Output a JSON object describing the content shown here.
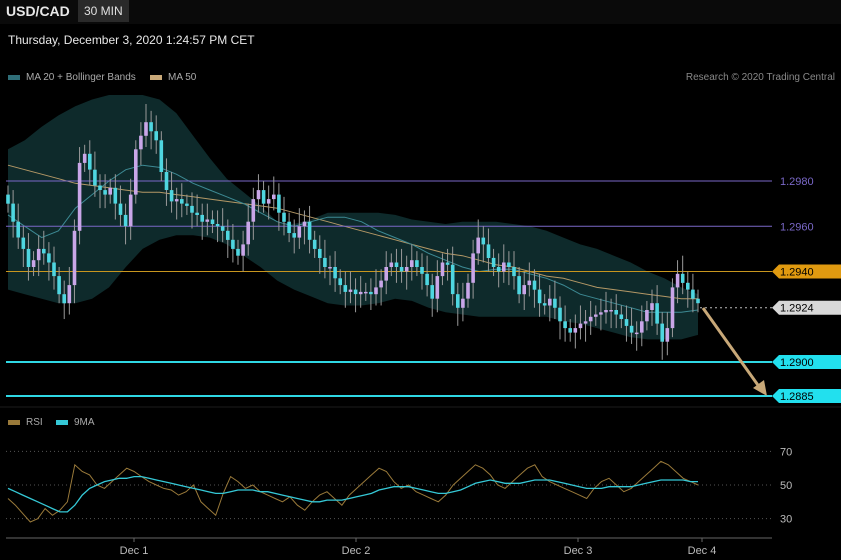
{
  "header": {
    "symbol": "USD/CAD",
    "timeframe": "30 MIN",
    "datetime": "Thursday, December 3, 2020 1:24:57 PM CET"
  },
  "legend": {
    "ma20_label": "MA 20 + Bollinger Bands",
    "ma50_label": "MA 50",
    "credit": "Research © 2020 Trading Central",
    "rsi_label": "RSI",
    "ma9_label": "9MA"
  },
  "colors": {
    "background": "#000000",
    "candle_up": "#c9a6e8",
    "candle_down": "#4fd6e0",
    "bollinger_fill": "#0e2a2b",
    "ma20": "#3d8a94",
    "ma50": "#b49866",
    "level_purple": "#7a68c8",
    "level_orange": "#c8961e",
    "level_cyan": "#2fd8e4",
    "rsi": "#9a7a3a",
    "rsi_ma": "#35c8d6",
    "arrow": "#c8a878"
  },
  "chart_data": [
    {
      "type": "candlestick",
      "title": "USD/CAD",
      "x_labels": [
        "Dec 1",
        "Dec 2",
        "Dec 3",
        "Dec 4"
      ],
      "ylim": [
        1.2875,
        1.3025
      ],
      "close_series": [
        1.297,
        1.2962,
        1.2955,
        1.295,
        1.2942,
        1.2945,
        1.295,
        1.2948,
        1.2944,
        1.2938,
        1.293,
        1.2926,
        1.2934,
        1.2958,
        1.2988,
        1.2992,
        1.2985,
        1.2978,
        1.2976,
        1.2974,
        1.2977,
        1.297,
        1.2965,
        1.296,
        1.2974,
        1.2994,
        1.3,
        1.3006,
        1.3002,
        1.2998,
        1.2984,
        1.2976,
        1.2971,
        1.2972,
        1.297,
        1.2969,
        1.2966,
        1.2965,
        1.2962,
        1.2963,
        1.2961,
        1.296,
        1.2958,
        1.2954,
        1.295,
        1.2947,
        1.2952,
        1.2962,
        1.2972,
        1.2976,
        1.297,
        1.2972,
        1.2974,
        1.2966,
        1.2962,
        1.2957,
        1.2955,
        1.296,
        1.2962,
        1.2954,
        1.295,
        1.2946,
        1.2942,
        1.2942,
        1.2937,
        1.2934,
        1.2931,
        1.2932,
        1.293,
        1.2931,
        1.2931,
        1.293,
        1.2933,
        1.2936,
        1.2942,
        1.2944,
        1.2942,
        1.294,
        1.2942,
        1.2945,
        1.2942,
        1.2939,
        1.2934,
        1.2928,
        1.2938,
        1.2944,
        1.2943,
        1.293,
        1.2924,
        1.2928,
        1.2935,
        1.2948,
        1.2955,
        1.2952,
        1.2946,
        1.2942,
        1.294,
        1.2944,
        1.2942,
        1.2938,
        1.293,
        1.2934,
        1.2936,
        1.2932,
        1.2926,
        1.2925,
        1.2928,
        1.2924,
        1.2918,
        1.2915,
        1.2913,
        1.2915,
        1.2917,
        1.2918,
        1.292,
        1.2921,
        1.2922,
        1.2923,
        1.2923,
        1.2921,
        1.2919,
        1.2916,
        1.2913,
        1.2913,
        1.2918,
        1.2923,
        1.2926,
        1.2917,
        1.2909,
        1.2915,
        1.2933,
        1.2939,
        1.2935,
        1.2932,
        1.2928,
        1.2926
      ],
      "bollinger_upper": [
        1.2994,
        1.2998,
        1.3004,
        1.3009,
        1.3013,
        1.3016,
        1.3018,
        1.3018,
        1.3018,
        1.3016,
        1.301,
        1.3,
        1.299,
        1.2981,
        1.2975,
        1.2969,
        1.2962,
        1.2961,
        1.2963,
        1.2966,
        1.2966,
        1.2966,
        1.2966,
        1.2965,
        1.2963,
        1.2962,
        1.2961,
        1.2962,
        1.2962,
        1.2962,
        1.2961,
        1.296,
        1.2958,
        1.2955,
        1.2952,
        1.295,
        1.2947,
        1.2944,
        1.294,
        1.2937,
        1.2933,
        1.293
      ],
      "bollinger_lower": [
        1.2932,
        1.293,
        1.2928,
        1.2926,
        1.2926,
        1.2928,
        1.2933,
        1.2942,
        1.295,
        1.2954,
        1.2956,
        1.2956,
        1.2955,
        1.2952,
        1.2947,
        1.2942,
        1.2936,
        1.2932,
        1.2929,
        1.2926,
        1.2925,
        1.2925,
        1.2926,
        1.2928,
        1.2927,
        1.2924,
        1.2922,
        1.2921,
        1.292,
        1.292,
        1.292,
        1.292,
        1.292,
        1.2918,
        1.2917,
        1.2915,
        1.2913,
        1.2911,
        1.291,
        1.291,
        1.291,
        1.2912
      ],
      "ma20": [
        1.2965,
        1.296,
        1.2955,
        1.2958,
        1.2968,
        1.2974,
        1.298,
        1.2985,
        1.2987,
        1.2986,
        1.2983,
        1.2979,
        1.2976,
        1.2973,
        1.297,
        1.2966,
        1.2962,
        1.296,
        1.2962,
        1.2964,
        1.2964,
        1.2962,
        1.2958,
        1.2955,
        1.2952,
        1.2948,
        1.2945,
        1.2942,
        1.294,
        1.2941,
        1.2941,
        1.2939,
        1.2937,
        1.2934,
        1.293,
        1.2928,
        1.2926,
        1.2924,
        1.2922,
        1.2922,
        1.2922,
        1.2923
      ],
      "ma50": [
        1.2987,
        1.2985,
        1.2983,
        1.2981,
        1.2979,
        1.2978,
        1.2977,
        1.2976,
        1.2975,
        1.2975,
        1.2974,
        1.2973,
        1.2972,
        1.2971,
        1.297,
        1.2969,
        1.2968,
        1.2966,
        1.2964,
        1.2962,
        1.296,
        1.2958,
        1.2956,
        1.2954,
        1.2952,
        1.295,
        1.2948,
        1.2947,
        1.2945,
        1.2943,
        1.2942,
        1.294,
        1.2938,
        1.2937,
        1.2935,
        1.2933,
        1.2932,
        1.2931,
        1.293,
        1.2929,
        1.2928,
        1.2928
      ],
      "levels": [
        {
          "value": 1.298,
          "label": "1.2980",
          "style": "purple"
        },
        {
          "value": 1.296,
          "label": "1.2960",
          "style": "purple"
        },
        {
          "value": 1.294,
          "label": "1.2940",
          "style": "orange"
        },
        {
          "value": 1.2924,
          "label": "1.2924",
          "style": "current"
        },
        {
          "value": 1.29,
          "label": "1.2900",
          "style": "cyan"
        },
        {
          "value": 1.2885,
          "label": "1.2885",
          "style": "cyan"
        }
      ],
      "forecast_target": 1.2885
    },
    {
      "type": "line",
      "title": "RSI",
      "ylim": [
        20,
        80
      ],
      "ticks": [
        {
          "value": 70,
          "label": "70"
        },
        {
          "value": 50,
          "label": "50"
        },
        {
          "value": 30,
          "label": "30"
        }
      ],
      "series": [
        {
          "name": "RSI",
          "values": [
            42,
            38,
            33,
            28,
            30,
            36,
            32,
            35,
            40,
            62,
            58,
            56,
            50,
            48,
            52,
            56,
            60,
            58,
            55,
            52,
            50,
            48,
            47,
            44,
            46,
            50,
            40,
            36,
            32,
            45,
            55,
            52,
            48,
            50,
            46,
            44,
            42,
            40,
            43,
            38,
            35,
            40,
            44,
            46,
            42,
            38,
            44,
            48,
            52,
            56,
            60,
            58,
            52,
            48,
            50,
            46,
            44,
            42,
            40,
            44,
            50,
            54,
            58,
            62,
            60,
            56,
            50,
            48,
            52,
            56,
            60,
            62,
            55,
            52,
            50,
            48,
            46,
            44,
            42,
            48,
            52,
            54,
            50,
            46,
            48,
            52,
            56,
            60,
            64,
            62,
            58,
            54,
            52,
            50
          ]
        },
        {
          "name": "9MA",
          "values": [
            48,
            46,
            44,
            42,
            40,
            38,
            36,
            34,
            34,
            38,
            44,
            48,
            50,
            52,
            53,
            54,
            54,
            55,
            55,
            54,
            53,
            52,
            51,
            50,
            49,
            48,
            47,
            46,
            45,
            45,
            46,
            47,
            47,
            47,
            46,
            46,
            45,
            44,
            43,
            42,
            41,
            40,
            40,
            41,
            41,
            41,
            42,
            43,
            44,
            45,
            47,
            48,
            49,
            49,
            49,
            48,
            47,
            46,
            45,
            45,
            46,
            47,
            49,
            51,
            52,
            53,
            52,
            51,
            51,
            51,
            52,
            53,
            53,
            53,
            52,
            51,
            50,
            49,
            48,
            48,
            48,
            49,
            49,
            49,
            49,
            50,
            51,
            52,
            53,
            53,
            53,
            53,
            52,
            52
          ]
        }
      ]
    }
  ]
}
